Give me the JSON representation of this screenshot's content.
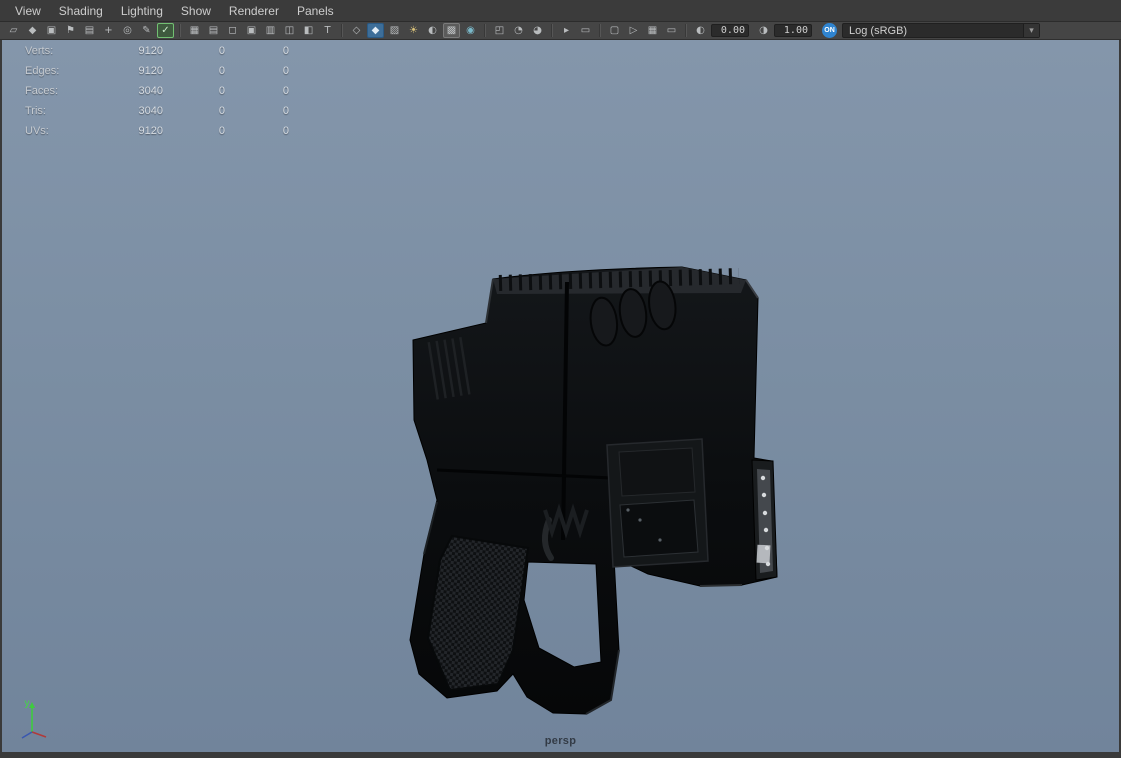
{
  "menu_bar": {
    "items": [
      {
        "label": "View"
      },
      {
        "label": "Shading"
      },
      {
        "label": "Lighting"
      },
      {
        "label": "Show"
      },
      {
        "label": "Renderer"
      },
      {
        "label": "Panels"
      }
    ]
  },
  "toolbar": {
    "groups": [
      {
        "icons": [
          {
            "name": "camera-select-icon",
            "glyph": "▱"
          },
          {
            "name": "camera-lock-icon",
            "glyph": "◆"
          },
          {
            "name": "camera-attributes-icon",
            "glyph": "▣"
          },
          {
            "name": "bookmark-icon",
            "glyph": "⚑"
          },
          {
            "name": "image-plane-icon",
            "glyph": "▤"
          },
          {
            "name": "pan-zoom-icon",
            "glyph": "+"
          },
          {
            "name": "snap-view-icon",
            "glyph": "◎"
          },
          {
            "name": "grease-pencil-icon",
            "glyph": "✎"
          },
          {
            "name": "highlight-selection-icon",
            "glyph": "✓",
            "state": "selected-green"
          }
        ]
      },
      {
        "icons": [
          {
            "name": "grid-icon",
            "glyph": "▦"
          },
          {
            "name": "film-gate-icon",
            "glyph": "▤"
          },
          {
            "name": "resolution-gate-icon",
            "glyph": "◻"
          },
          {
            "name": "gate-mask-icon",
            "glyph": "▣"
          },
          {
            "name": "field-chart-icon",
            "glyph": "▥"
          },
          {
            "name": "safe-action-icon",
            "glyph": "◫"
          },
          {
            "name": "safe-title-icon",
            "glyph": "◧"
          },
          {
            "name": "hud-text-icon",
            "glyph": "T"
          }
        ]
      },
      {
        "icons": [
          {
            "name": "wireframe-icon",
            "glyph": "◇"
          },
          {
            "name": "smooth-shade-icon",
            "glyph": "◆",
            "state": "active-blue"
          },
          {
            "name": "textured-icon",
            "glyph": "▨"
          },
          {
            "name": "use-all-lights-icon",
            "glyph": "☀",
            "color": "#d9c27a"
          },
          {
            "name": "shadows-icon",
            "glyph": "◐"
          },
          {
            "name": "screen-space-ao-icon",
            "glyph": "▩",
            "state": "selected"
          },
          {
            "name": "anti-aliasing-icon",
            "glyph": "◉",
            "color": "#7ab8c9"
          }
        ]
      },
      {
        "icons": [
          {
            "name": "isolate-select-icon",
            "glyph": "◰"
          },
          {
            "name": "xray-icon",
            "glyph": "◔"
          },
          {
            "name": "xray-joints-icon",
            "glyph": "◕"
          }
        ]
      },
      {
        "icons": [
          {
            "name": "camera-sequencer-icon",
            "glyph": "▸"
          },
          {
            "name": "clapper-icon",
            "glyph": "▭"
          }
        ]
      },
      {
        "icons": [
          {
            "name": "snapshot-icon",
            "glyph": "▢"
          },
          {
            "name": "playblast-icon",
            "glyph": "▷"
          },
          {
            "name": "render-view-icon",
            "glyph": "▦"
          },
          {
            "name": "letterbox-icon",
            "glyph": "▭"
          }
        ]
      }
    ],
    "exposure": {
      "icon_glyph": "◐",
      "value": "0.00"
    },
    "gamma": {
      "icon_glyph": "◑",
      "value": "1.00"
    },
    "color_management": {
      "toggle_label": "ON",
      "view_transform": "Log (sRGB)",
      "arrow_glyph": "▾"
    }
  },
  "hud": {
    "rows": [
      {
        "label": "Verts:",
        "total": "9120",
        "col2": "0",
        "col3": "0"
      },
      {
        "label": "Edges:",
        "total": "9120",
        "col2": "0",
        "col3": "0"
      },
      {
        "label": "Faces:",
        "total": "3040",
        "col2": "0",
        "col3": "0"
      },
      {
        "label": "Tris:",
        "total": "3040",
        "col2": "0",
        "col3": "0"
      },
      {
        "label": "UVs:",
        "total": "9120",
        "col2": "0",
        "col3": "0"
      }
    ]
  },
  "viewport": {
    "camera_label": "persp",
    "axis_y_label": "y"
  },
  "colors": {
    "chrome_bg": "#3b3b3b",
    "toolbar_bg": "#454545",
    "viewport_top": "#8496ab",
    "viewport_bottom": "#71849b",
    "accent_blue": "#3d6e99",
    "field_bg": "#2b2b2b"
  }
}
